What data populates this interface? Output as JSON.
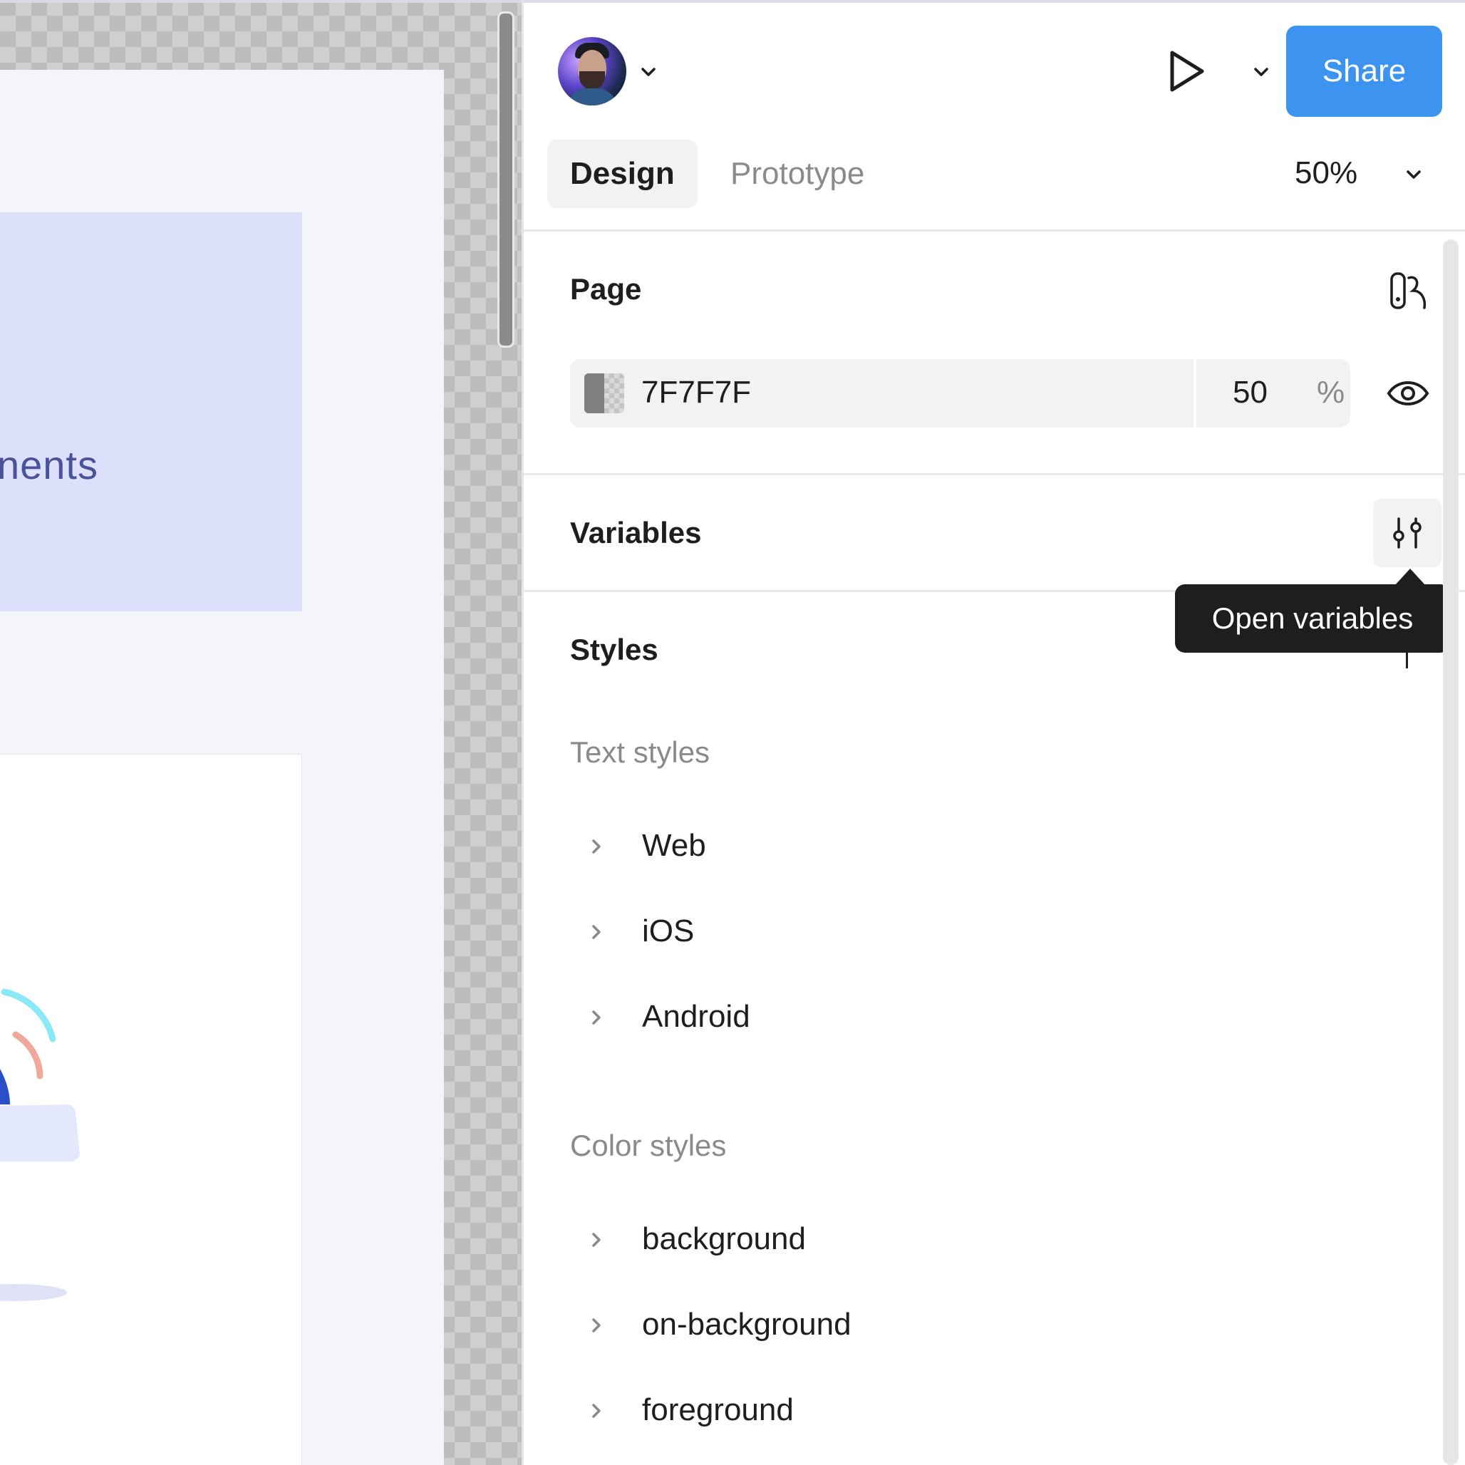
{
  "canvas": {
    "banner_text": "nents"
  },
  "header": {
    "avatar_alt": "User avatar",
    "share_label": "Share"
  },
  "tabs": {
    "design": "Design",
    "prototype": "Prototype",
    "zoom": "50%"
  },
  "page_section": {
    "title": "Page",
    "color_hex": "7F7F7F",
    "opacity_value": "50",
    "opacity_unit": "%"
  },
  "variables_section": {
    "title": "Variables",
    "tooltip": "Open variables"
  },
  "styles_section": {
    "title": "Styles",
    "text_styles_heading": "Text styles",
    "text_styles": [
      {
        "label": "Web"
      },
      {
        "label": "iOS"
      },
      {
        "label": "Android"
      }
    ],
    "color_styles_heading": "Color styles",
    "color_styles": [
      {
        "label": "background"
      },
      {
        "label": "on-background"
      },
      {
        "label": "foreground"
      }
    ]
  },
  "colors": {
    "accent": "#3d94f0",
    "canvas_banner": "#dde0fa",
    "tooltip_bg": "#1e1e1e"
  },
  "icons": {
    "play": "play-icon",
    "chevron_down": "chevron-down-icon",
    "chevron_right": "chevron-right-icon",
    "page_icon": "page-layout-icon",
    "eye": "eye-icon",
    "variables": "sliders-icon"
  }
}
